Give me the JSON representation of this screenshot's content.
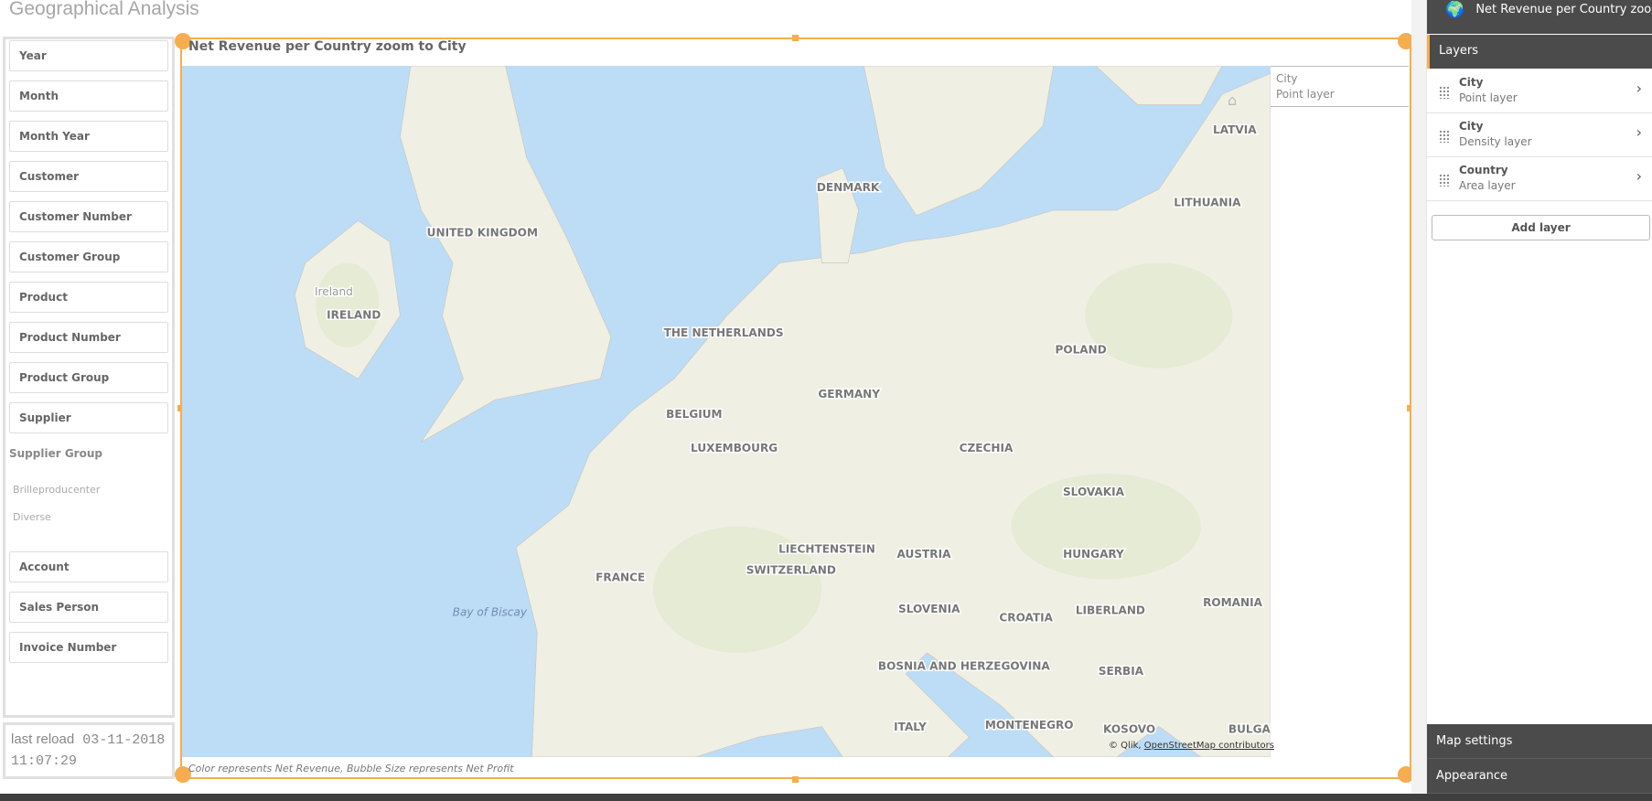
{
  "sheet_title": "Geographical Analysis",
  "filters": [
    "Year",
    "Month",
    "Month Year",
    "Customer",
    "Customer Number",
    "Customer Group",
    "Product",
    "Product Number",
    "Product Group",
    "Supplier"
  ],
  "supplier_group": {
    "label": "Supplier Group",
    "values": [
      "Brilleproducenter",
      "Diverse"
    ]
  },
  "filters2": [
    "Account",
    "Sales Person",
    "Invoice Number"
  ],
  "reload": {
    "prefix": "last reload",
    "date": "03-11-2018",
    "time": "11:07:29"
  },
  "chart": {
    "title": "Net Revenue per Country zoom to City",
    "footnote": "Color represents Net Revenue, Bubble Size represents Net Profit",
    "legend": {
      "title": "City",
      "subtitle": "Point layer"
    },
    "attribution": {
      "prefix": "© Qlik,",
      "link": "OpenStreetMap contributors"
    },
    "colors": {
      "sea": "#bddcf6",
      "land": "#f0efe4",
      "selection": "#f5ad4f"
    },
    "labels": [
      "UNITED KINGDOM",
      "Ireland",
      "IRELAND",
      "DENMARK",
      "LATVIA",
      "LITHUANIA",
      "THE NETHERLANDS",
      "POLAND",
      "GERMANY",
      "BELGIUM",
      "LUXEMBOURG",
      "CZECHIA",
      "SLOVAKIA",
      "LIECHTENSTEIN",
      "AUSTRIA",
      "HUNGARY",
      "SWITZERLAND",
      "FRANCE",
      "Bay of Biscay",
      "SLOVENIA",
      "CROATIA",
      "LIBERLAND",
      "ROMANIA",
      "BOSNIA AND HERZEGOVINA",
      "SERBIA",
      "ITALY",
      "MONTENEGRO",
      "KOSOVO",
      "BULGAR"
    ]
  },
  "properties": {
    "header": "Net Revenue per Country zoom t...",
    "header_icon": "globe-icon",
    "section": "Layers",
    "layers": [
      {
        "name": "City",
        "type": "Point layer"
      },
      {
        "name": "City",
        "type": "Density layer"
      },
      {
        "name": "Country",
        "type": "Area layer"
      }
    ],
    "add_layer": "Add layer",
    "map_settings": "Map settings",
    "appearance": "Appearance"
  }
}
